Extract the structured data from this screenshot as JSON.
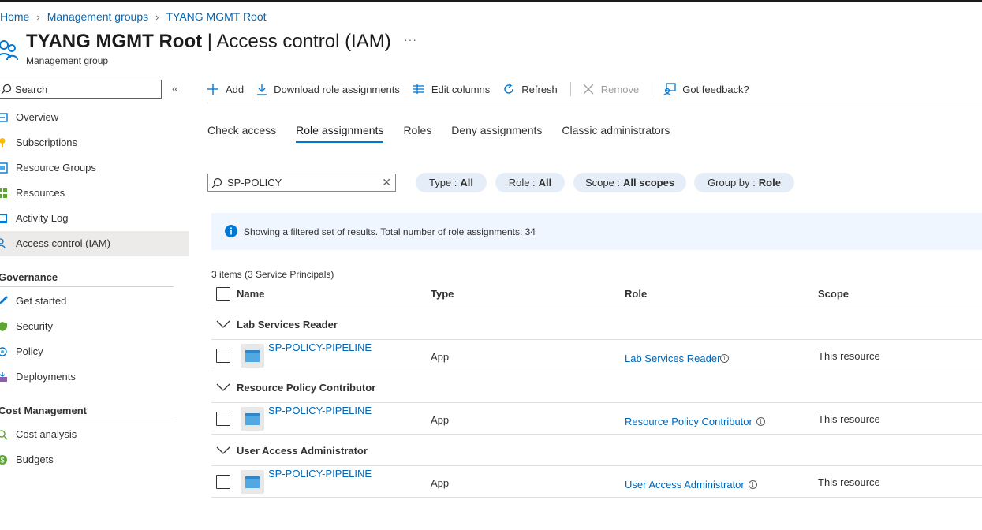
{
  "breadcrumb": [
    "Home",
    "Management groups",
    "TYANG MGMT Root"
  ],
  "header": {
    "title_bold": "TYANG MGMT Root",
    "title_rest": " | Access control (IAM)",
    "subtitle": "Management group",
    "more": "···"
  },
  "sidebar": {
    "search_placeholder": "Search",
    "collapse": "«",
    "items": [
      {
        "label": "Overview",
        "icon": "overview-icon"
      },
      {
        "label": "Subscriptions",
        "icon": "key-icon"
      },
      {
        "label": "Resource Groups",
        "icon": "resource-group-icon"
      },
      {
        "label": "Resources",
        "icon": "grid-icon"
      },
      {
        "label": "Activity Log",
        "icon": "log-icon"
      },
      {
        "label": "Access control (IAM)",
        "icon": "people-icon"
      }
    ],
    "governance_title": "Governance",
    "governance": [
      {
        "label": "Get started",
        "icon": "rocket-icon"
      },
      {
        "label": "Security",
        "icon": "shield-icon"
      },
      {
        "label": "Policy",
        "icon": "policy-icon"
      },
      {
        "label": "Deployments",
        "icon": "deployments-icon"
      }
    ],
    "cost_title": "Cost Management",
    "cost": [
      {
        "label": "Cost analysis",
        "icon": "cost-analysis-icon"
      },
      {
        "label": "Budgets",
        "icon": "budget-icon"
      }
    ]
  },
  "toolbar": {
    "add": "Add",
    "download": "Download role assignments",
    "edit_columns": "Edit columns",
    "refresh": "Refresh",
    "remove": "Remove",
    "feedback": "Got feedback?"
  },
  "tabs": [
    "Check access",
    "Role assignments",
    "Roles",
    "Deny assignments",
    "Classic administrators"
  ],
  "active_tab": "Role assignments",
  "filter": {
    "value": "SP-POLICY",
    "pills": [
      {
        "key": "Type :",
        "value": "All"
      },
      {
        "key": "Role :",
        "value": "All"
      },
      {
        "key": "Scope :",
        "value": "All scopes"
      },
      {
        "key": "Group by :",
        "value": "Role"
      }
    ]
  },
  "info_banner": "Showing a filtered set of results. Total number of role assignments: 34",
  "table": {
    "count": "3 items (3 Service Principals)",
    "columns": [
      "Name",
      "Type",
      "Role",
      "Scope"
    ],
    "groups": [
      {
        "label": "Lab Services Reader",
        "row": {
          "name": "SP-POLICY-PIPELINE",
          "type": "App",
          "role": "Lab Services Reader",
          "scope": "This resource"
        }
      },
      {
        "label": "Resource Policy Contributor",
        "row": {
          "name": "SP-POLICY-PIPELINE",
          "type": "App",
          "role": "Resource Policy Contributor",
          "scope": "This resource"
        }
      },
      {
        "label": "User Access Administrator",
        "row": {
          "name": "SP-POLICY-PIPELINE",
          "type": "App",
          "role": "User Access Administrator",
          "scope": "This resource"
        }
      }
    ]
  },
  "colors": {
    "accent": "#0078d4",
    "link": "#0067b8",
    "banner": "#f0f6ff",
    "pill": "#e5eef8",
    "active_nav": "#edebe9"
  }
}
